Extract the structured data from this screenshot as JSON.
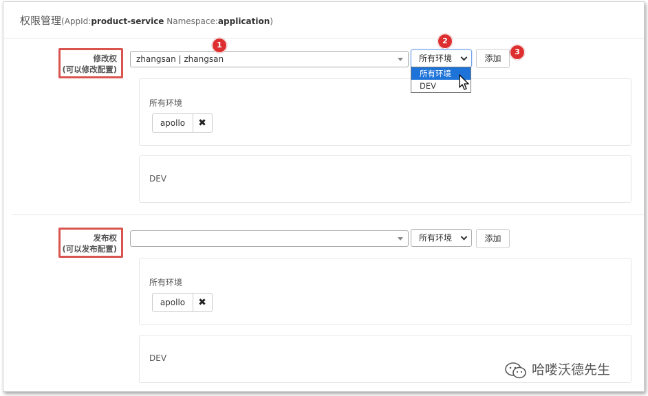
{
  "header": {
    "title": "权限管理",
    "appid_prefix": "(AppId:",
    "appid_value": "product-service",
    "namespace_prefix": " Namespace:",
    "namespace_value": "application",
    "suffix": ")"
  },
  "modify_section": {
    "label_line1": "修改权",
    "label_line2": "(可以修改配置)",
    "user_value": "zhangsan | zhangsan",
    "env_value": "所有环境",
    "add_label": "添加",
    "dropdown_options": [
      "所有环境",
      "DEV"
    ],
    "panels": [
      {
        "title": "所有环境",
        "tags": [
          {
            "name": "apollo",
            "remove": "✖"
          }
        ]
      },
      {
        "title": "DEV",
        "tags": []
      }
    ]
  },
  "release_section": {
    "label_line1": "发布权",
    "label_line2": "(可以发布配置)",
    "user_value": "",
    "env_value": "所有环境",
    "add_label": "添加",
    "panels": [
      {
        "title": "所有环境",
        "tags": [
          {
            "name": "apollo",
            "remove": "✖"
          }
        ]
      },
      {
        "title": "DEV",
        "tags": []
      }
    ]
  },
  "badges": [
    "1",
    "2",
    "3"
  ],
  "watermark": "哈喽沃德先生",
  "colors": {
    "highlight_red": "#d9534f",
    "badge_red": "#dd2f2f",
    "selected_blue": "#1e73d8"
  }
}
